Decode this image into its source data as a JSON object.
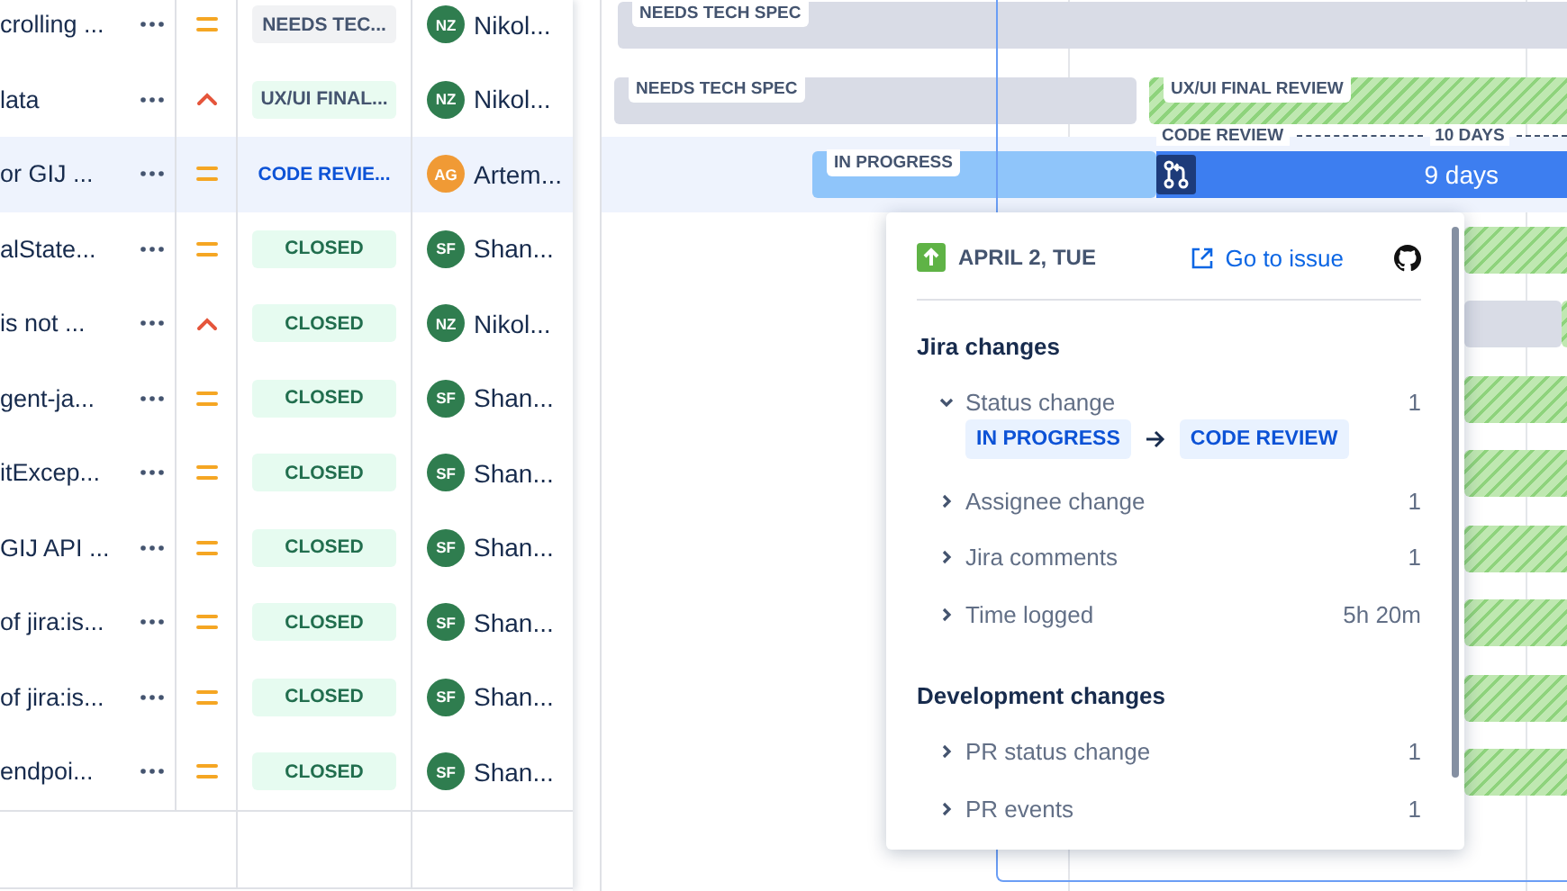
{
  "table": {
    "rows": [
      {
        "title": "crolling ...",
        "high_priority": false,
        "status": {
          "label": "NEEDS TEC...",
          "kind": "gray"
        },
        "assignee": {
          "initials": "NZ",
          "name": "Nikol...",
          "color": "#2f7d4f"
        },
        "selected": false
      },
      {
        "title": "lata",
        "high_priority": true,
        "status": {
          "label": "UX/UI FINAL...",
          "kind": "green"
        },
        "assignee": {
          "initials": "NZ",
          "name": "Nikol...",
          "color": "#2f7d4f"
        },
        "selected": false
      },
      {
        "title": "or GIJ ...",
        "high_priority": false,
        "status": {
          "label": "CODE REVIE...",
          "kind": "blue"
        },
        "assignee": {
          "initials": "AG",
          "name": "Artem...",
          "color": "#f09a35"
        },
        "selected": true
      },
      {
        "title": "alState...",
        "high_priority": false,
        "status": {
          "label": "CLOSED",
          "kind": "closed"
        },
        "assignee": {
          "initials": "SF",
          "name": "Shan...",
          "color": "#2f7d4f"
        },
        "selected": false
      },
      {
        "title": "is not ...",
        "high_priority": true,
        "status": {
          "label": "CLOSED",
          "kind": "closed"
        },
        "assignee": {
          "initials": "NZ",
          "name": "Nikol...",
          "color": "#2f7d4f"
        },
        "selected": false
      },
      {
        "title": "gent-ja...",
        "high_priority": false,
        "status": {
          "label": "CLOSED",
          "kind": "closed"
        },
        "assignee": {
          "initials": "SF",
          "name": "Shan...",
          "color": "#2f7d4f"
        },
        "selected": false
      },
      {
        "title": "itExcep...",
        "high_priority": false,
        "status": {
          "label": "CLOSED",
          "kind": "closed"
        },
        "assignee": {
          "initials": "SF",
          "name": "Shan...",
          "color": "#2f7d4f"
        },
        "selected": false
      },
      {
        "title": "GIJ API ...",
        "high_priority": false,
        "status": {
          "label": "CLOSED",
          "kind": "closed"
        },
        "assignee": {
          "initials": "SF",
          "name": "Shan...",
          "color": "#2f7d4f"
        },
        "selected": false
      },
      {
        "title": "of jira:is...",
        "high_priority": false,
        "status": {
          "label": "CLOSED",
          "kind": "closed"
        },
        "assignee": {
          "initials": "SF",
          "name": "Shan...",
          "color": "#2f7d4f"
        },
        "selected": false
      },
      {
        "title": "of jira:is...",
        "high_priority": false,
        "status": {
          "label": "CLOSED",
          "kind": "closed"
        },
        "assignee": {
          "initials": "SF",
          "name": "Shan...",
          "color": "#2f7d4f"
        },
        "selected": false
      },
      {
        "title": "endpoi...",
        "high_priority": false,
        "status": {
          "label": "CLOSED",
          "kind": "closed"
        },
        "assignee": {
          "initials": "SF",
          "name": "Shan...",
          "color": "#2f7d4f"
        },
        "selected": false
      }
    ]
  },
  "gantt": {
    "rows": [
      {
        "bars": [
          {
            "kind": "gray",
            "label": "NEEDS TECH SPEC"
          }
        ]
      },
      {
        "bars": [
          {
            "kind": "gray",
            "label": "NEEDS TECH SPEC"
          },
          {
            "kind": "hatched",
            "label": "UX/UI FINAL REVIEW"
          }
        ]
      },
      {
        "phase": {
          "label": "CODE REVIEW",
          "duration": "10 DAYS"
        },
        "bars": [
          {
            "kind": "progress",
            "label": "IN PROGRESS"
          },
          {
            "kind": "review",
            "duration": "9 days"
          }
        ]
      },
      {
        "bars": [
          {
            "kind": "hatched"
          }
        ]
      },
      {
        "bars": [
          {
            "kind": "gray"
          },
          {
            "kind": "hatched"
          }
        ]
      },
      {
        "bars": [
          {
            "kind": "hatched"
          }
        ]
      },
      {
        "bars": [
          {
            "kind": "hatched"
          }
        ]
      },
      {
        "bars": [
          {
            "kind": "hatched"
          }
        ]
      },
      {
        "bars": [
          {
            "kind": "hatched"
          }
        ]
      },
      {
        "bars": [
          {
            "kind": "hatched"
          }
        ]
      },
      {
        "bars": [
          {
            "kind": "hatched"
          }
        ]
      }
    ]
  },
  "popover": {
    "date": "APRIL 2, TUE",
    "link": "Go to issue",
    "sections": [
      {
        "title": "Jira changes",
        "items": [
          {
            "label": "Status change",
            "value": "1",
            "expanded": true,
            "from": "IN PROGRESS",
            "to": "CODE REVIEW"
          },
          {
            "label": "Assignee change",
            "value": "1",
            "expanded": false
          },
          {
            "label": "Jira comments",
            "value": "1",
            "expanded": false
          },
          {
            "label": "Time logged",
            "value": "5h 20m",
            "expanded": false
          }
        ]
      },
      {
        "title": "Development changes",
        "items": [
          {
            "label": "PR status change",
            "value": "1",
            "expanded": false
          },
          {
            "label": "PR events",
            "value": "1",
            "expanded": false
          }
        ]
      }
    ]
  }
}
